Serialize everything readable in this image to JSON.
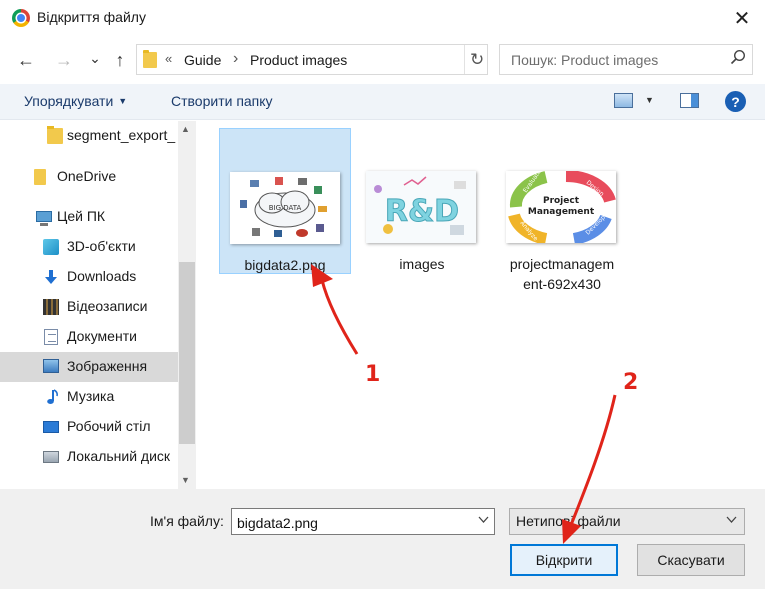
{
  "window": {
    "title": "Відкриття файлу",
    "close_glyph": "✕"
  },
  "address": {
    "back_glyph": "←",
    "forward_glyph": "→",
    "dropdown_glyph": "⌄",
    "up_glyph": "↑",
    "overflow_glyph": "«",
    "separator_glyph": "›",
    "segments": [
      "Guide",
      "Product images"
    ],
    "refresh_glyph": "↻"
  },
  "search": {
    "placeholder": "Пошук: Product images",
    "icon_glyph": "⌕"
  },
  "toolbar": {
    "organize_label": "Упорядкувати",
    "organize_caret": "▼",
    "new_folder_label": "Створити папку",
    "view_caret": "▼",
    "help_glyph": "?"
  },
  "nav": {
    "items": [
      {
        "label": "segment_export_",
        "icon": "folder-icon"
      },
      {
        "label": "OneDrive",
        "icon": "onedrive-icon"
      },
      {
        "label": "Цей ПК",
        "icon": "computer-icon"
      },
      {
        "label": "3D-об'єкти",
        "icon": "3d-objects-icon"
      },
      {
        "label": "Downloads",
        "icon": "download-icon"
      },
      {
        "label": "Відеозаписи",
        "icon": "video-icon"
      },
      {
        "label": "Документи",
        "icon": "document-icon"
      },
      {
        "label": "Зображення",
        "icon": "pictures-icon",
        "selected": true
      },
      {
        "label": "Музика",
        "icon": "music-icon"
      },
      {
        "label": "Робочий стіл",
        "icon": "desktop-icon"
      },
      {
        "label": "Локальний диск",
        "icon": "local-disk-icon"
      }
    ],
    "scroll_up_glyph": "▲",
    "scroll_down_glyph": "▼"
  },
  "files": [
    {
      "name": "bigdata2.png",
      "selected": true,
      "thumb_text": "BIG DATA"
    },
    {
      "name": "images",
      "selected": false,
      "thumb_text": "R&D"
    },
    {
      "name": "projectmanagem ent-692x430",
      "selected": false,
      "thumb_text": "Project Management",
      "thumb_words": [
        "Evaluate",
        "Design",
        "Analyze",
        "Develop"
      ]
    }
  ],
  "footer": {
    "filename_label": "Ім'я файлу:",
    "filename_value": "bigdata2.png",
    "dropdown_glyph": "⌄",
    "filetype_value": "Нетипові файли",
    "open_label": "Відкрити",
    "cancel_label": "Скасувати"
  },
  "annotations": {
    "marker_1": "1",
    "marker_2": "2",
    "color": "#e0241a"
  }
}
